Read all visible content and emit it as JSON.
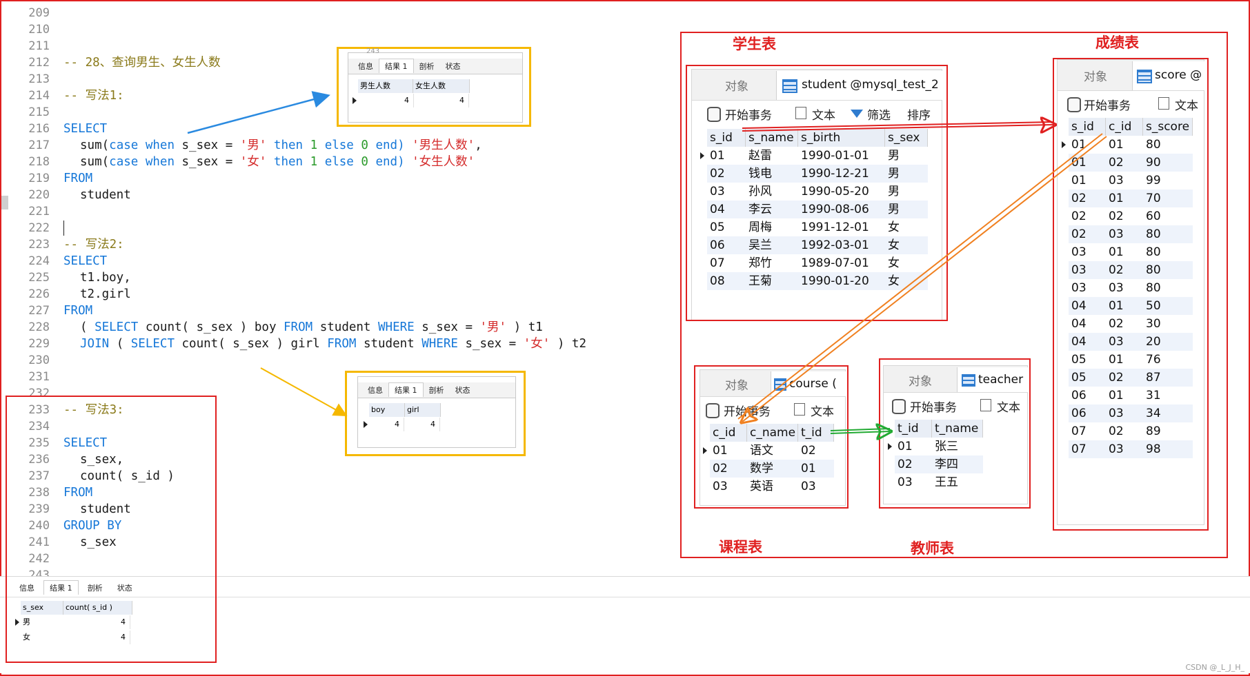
{
  "editor": {
    "line_numbers": [
      "209",
      "210",
      "211",
      "212",
      "213",
      "214",
      "215",
      "216",
      "217",
      "218",
      "219",
      "220",
      "221",
      "222",
      "223",
      "224",
      "225",
      "226",
      "227",
      "228",
      "229",
      "230",
      "231",
      "232",
      "233",
      "234",
      "235",
      "236",
      "237",
      "238",
      "239",
      "240",
      "241",
      "242",
      "243"
    ],
    "code": {
      "l212": "-- 28、查询男生、女生人数",
      "l214": "-- 写法1:",
      "select": "SELECT",
      "from": "FROM",
      "student": "student",
      "sum": "sum(",
      "case_when": "case when",
      "s_sex_eq": " s_sex = ",
      "male": "'男'",
      "female": "'女'",
      "then": " then ",
      "one": "1",
      "else": " else ",
      "zero": "0",
      "end": " end) ",
      "alias_male": "'男生人数'",
      "alias_female": "'女生人数'",
      "comma": ",",
      "l223": "-- 写法2:",
      "l225": "t1.boy,",
      "l226": "t2.girl",
      "l228_open": "( ",
      "l228_select": "SELECT",
      "l228_count": " count( s_sex ) boy ",
      "l228_from": "FROM",
      "l228_student": " student ",
      "where": "WHERE",
      "l228_cond": " s_sex = ",
      "l228_close": " ) t1",
      "join": "JOIN",
      "l229_open": " ( ",
      "l229_count": " count( s_sex ) girl ",
      "l229_close": " ) t2",
      "l233": "-- 写法3:",
      "l236": "s_sex,",
      "l237": "count( s_id )",
      "group_by": "GROUP BY",
      "l241": "s_sex"
    }
  },
  "result_tabs": [
    "信息",
    "结果 1",
    "剖析",
    "状态"
  ],
  "result1": {
    "headers": [
      "男生人数",
      "女生人数"
    ],
    "values": [
      "4",
      "4"
    ],
    "peek_line": "243"
  },
  "result2": {
    "headers": [
      "boy",
      "girl"
    ],
    "values": [
      "4",
      "4"
    ]
  },
  "result3": {
    "headers": [
      "s_sex",
      "count( s_id )"
    ],
    "rows": [
      [
        "男",
        "4"
      ],
      [
        "女",
        "4"
      ]
    ]
  },
  "labels": {
    "student": "学生表",
    "score": "成绩表",
    "course": "课程表",
    "teacher": "教师表"
  },
  "common": {
    "objects_tab": "对象",
    "begin_tx": "开始事务",
    "text": "文本",
    "filter": "筛选",
    "sort": "排序"
  },
  "student_win": {
    "title": "student @mysql_test_2(",
    "headers": [
      "s_id",
      "s_name",
      "s_birth",
      "s_sex"
    ],
    "rows": [
      [
        "01",
        "赵雷",
        "1990-01-01",
        "男"
      ],
      [
        "02",
        "钱电",
        "1990-12-21",
        "男"
      ],
      [
        "03",
        "孙风",
        "1990-05-20",
        "男"
      ],
      [
        "04",
        "李云",
        "1990-08-06",
        "男"
      ],
      [
        "05",
        "周梅",
        "1991-12-01",
        "女"
      ],
      [
        "06",
        "吴兰",
        "1992-03-01",
        "女"
      ],
      [
        "07",
        "郑竹",
        "1989-07-01",
        "女"
      ],
      [
        "08",
        "王菊",
        "1990-01-20",
        "女"
      ]
    ]
  },
  "score_win": {
    "title": "score @",
    "headers": [
      "s_id",
      "c_id",
      "s_score"
    ],
    "rows": [
      [
        "01",
        "01",
        "80"
      ],
      [
        "01",
        "02",
        "90"
      ],
      [
        "01",
        "03",
        "99"
      ],
      [
        "02",
        "01",
        "70"
      ],
      [
        "02",
        "02",
        "60"
      ],
      [
        "02",
        "03",
        "80"
      ],
      [
        "03",
        "01",
        "80"
      ],
      [
        "03",
        "02",
        "80"
      ],
      [
        "03",
        "03",
        "80"
      ],
      [
        "04",
        "01",
        "50"
      ],
      [
        "04",
        "02",
        "30"
      ],
      [
        "04",
        "03",
        "20"
      ],
      [
        "05",
        "01",
        "76"
      ],
      [
        "05",
        "02",
        "87"
      ],
      [
        "06",
        "01",
        "31"
      ],
      [
        "06",
        "03",
        "34"
      ],
      [
        "07",
        "02",
        "89"
      ],
      [
        "07",
        "03",
        "98"
      ]
    ]
  },
  "course_win": {
    "title": "course (",
    "headers": [
      "c_id",
      "c_name",
      "t_id"
    ],
    "rows": [
      [
        "01",
        "语文",
        "02"
      ],
      [
        "02",
        "数学",
        "01"
      ],
      [
        "03",
        "英语",
        "03"
      ]
    ]
  },
  "teacher_win": {
    "title": "teacher",
    "headers": [
      "t_id",
      "t_name"
    ],
    "rows": [
      [
        "01",
        "张三"
      ],
      [
        "02",
        "李四"
      ],
      [
        "03",
        "王五"
      ]
    ]
  },
  "watermark": "CSDN @_L_J_H_",
  "colors": {
    "keyword": "#1577d8",
    "string": "#d42b2b",
    "number": "#2a9a2a",
    "comment": "#8a7a1a",
    "annotation_red": "#e02020",
    "highlight_yellow": "#f5b800",
    "arrow_blue": "#2a8ae0",
    "arrow_red": "#e02020",
    "arrow_orange": "#f08020",
    "arrow_green": "#22aa33"
  }
}
